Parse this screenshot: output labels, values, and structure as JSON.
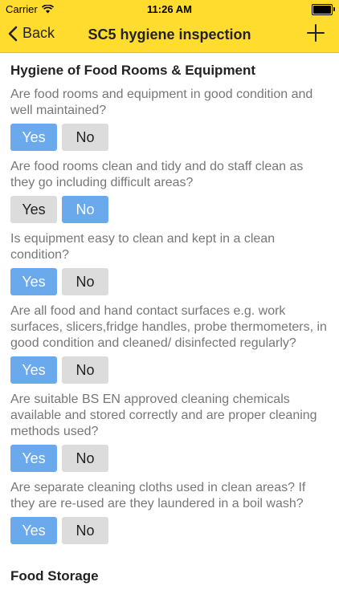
{
  "status_bar": {
    "carrier": "Carrier",
    "time": "11:26 AM"
  },
  "nav": {
    "back_label": "Back",
    "title": "SC5 hygiene inspection"
  },
  "sections": [
    {
      "title": "Hygiene of Food Rooms & Equipment",
      "questions": [
        {
          "text": "Are food rooms and equipment in good condition and well maintained?",
          "yes": "Yes",
          "no": "No",
          "selected": "yes"
        },
        {
          "text": "Are food rooms clean and tidy and do staff clean as they go including difficult areas?",
          "yes": "Yes",
          "no": "No",
          "selected": "no"
        },
        {
          "text": "Is equipment easy to clean and kept in a clean condition?",
          "yes": "Yes",
          "no": "No",
          "selected": "yes"
        },
        {
          "text": "Are all food and hand contact surfaces e.g. work surfaces, slicers,fridge handles, probe thermometers, in good condition and cleaned/ disinfected regularly?",
          "yes": "Yes",
          "no": "No",
          "selected": "yes"
        },
        {
          "text": "Are suitable BS EN approved cleaning chemicals available and stored correctly and are proper cleaning methods used?",
          "yes": "Yes",
          "no": "No",
          "selected": "yes"
        },
        {
          "text": "Are separate cleaning cloths used in clean areas? If they are re-used are they laundered in a boil wash?",
          "yes": "Yes",
          "no": "No",
          "selected": "yes"
        }
      ]
    },
    {
      "title": "Food Storage",
      "questions": []
    }
  ],
  "colors": {
    "nav_background": "#ffdc2e",
    "selected_button": "#6aa9ec",
    "unselected_button": "#dcdcdc"
  }
}
